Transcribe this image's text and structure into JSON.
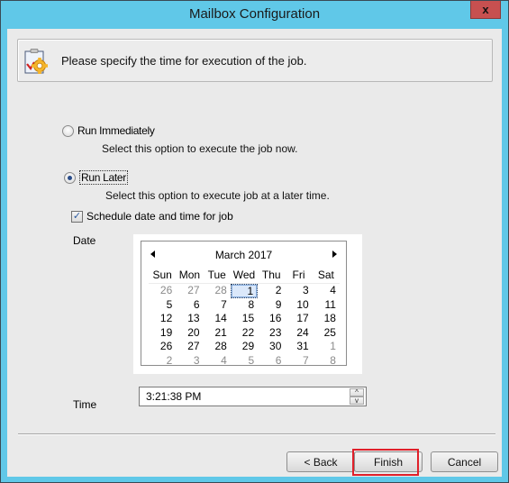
{
  "window": {
    "title": "Mailbox Configuration",
    "close_label": "x"
  },
  "header": {
    "icon": "clipboard-gear-icon",
    "text": "Please specify the time for execution of the job."
  },
  "options": {
    "run_immediately": {
      "label": "Run Immediately",
      "description": "Select this option to execute the job now.",
      "checked": false
    },
    "run_later": {
      "label": "Run Later",
      "description": "Select this option to execute job at a later time.",
      "checked": true
    },
    "schedule": {
      "label": "Schedule date and time for job",
      "checked": true
    }
  },
  "date": {
    "label": "Date",
    "calendar": {
      "month_title": "March 2017",
      "prev_icon": "triangle-left-icon",
      "next_icon": "triangle-right-icon",
      "weekdays": [
        "Sun",
        "Mon",
        "Tue",
        "Wed",
        "Thu",
        "Fri",
        "Sat"
      ],
      "weeks": [
        [
          "26",
          "27",
          "28",
          "1",
          "2",
          "3",
          "4"
        ],
        [
          "5",
          "6",
          "7",
          "8",
          "9",
          "10",
          "11"
        ],
        [
          "12",
          "13",
          "14",
          "15",
          "16",
          "17",
          "18"
        ],
        [
          "19",
          "20",
          "21",
          "22",
          "23",
          "24",
          "25"
        ],
        [
          "26",
          "27",
          "28",
          "29",
          "30",
          "31",
          "1"
        ],
        [
          "2",
          "3",
          "4",
          "5",
          "6",
          "7",
          "8"
        ]
      ],
      "selected_day": "1"
    }
  },
  "time": {
    "label": "Time",
    "value": "3:21:38 PM",
    "up_icon": "^",
    "down_icon": "v"
  },
  "buttons": {
    "back": "< Back",
    "finish": "Finish",
    "cancel": "Cancel"
  },
  "colors": {
    "titlebar": "#60c8e8",
    "close_button": "#c75050",
    "highlight": "#e0202a"
  }
}
